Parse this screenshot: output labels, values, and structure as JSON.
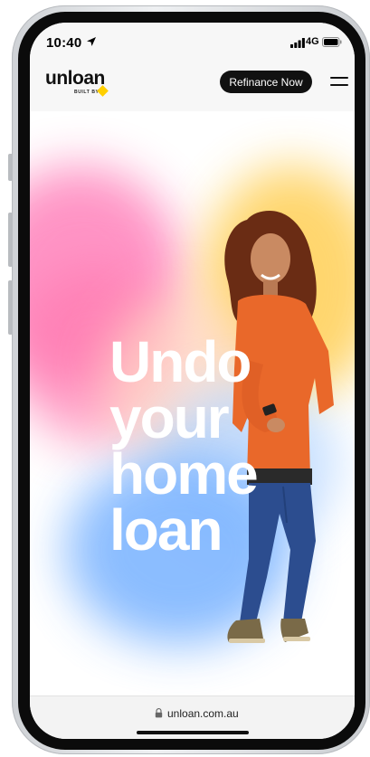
{
  "status_bar": {
    "time": "10:40",
    "network": "4G"
  },
  "header": {
    "logo_text": "unloan",
    "logo_subtext": "BUILT BY",
    "cta_label": "Refinance Now"
  },
  "hero": {
    "headline_lines": [
      "Undo",
      "your",
      "home",
      "loan"
    ]
  },
  "browser": {
    "url": "unloan.com.au"
  },
  "colors": {
    "accent_yellow": "#ffcf00",
    "button_bg": "#111111",
    "headline": "#ffffff"
  },
  "icons": [
    "location-arrow-icon",
    "signal-icon",
    "battery-icon",
    "menu-icon",
    "lock-icon"
  ]
}
